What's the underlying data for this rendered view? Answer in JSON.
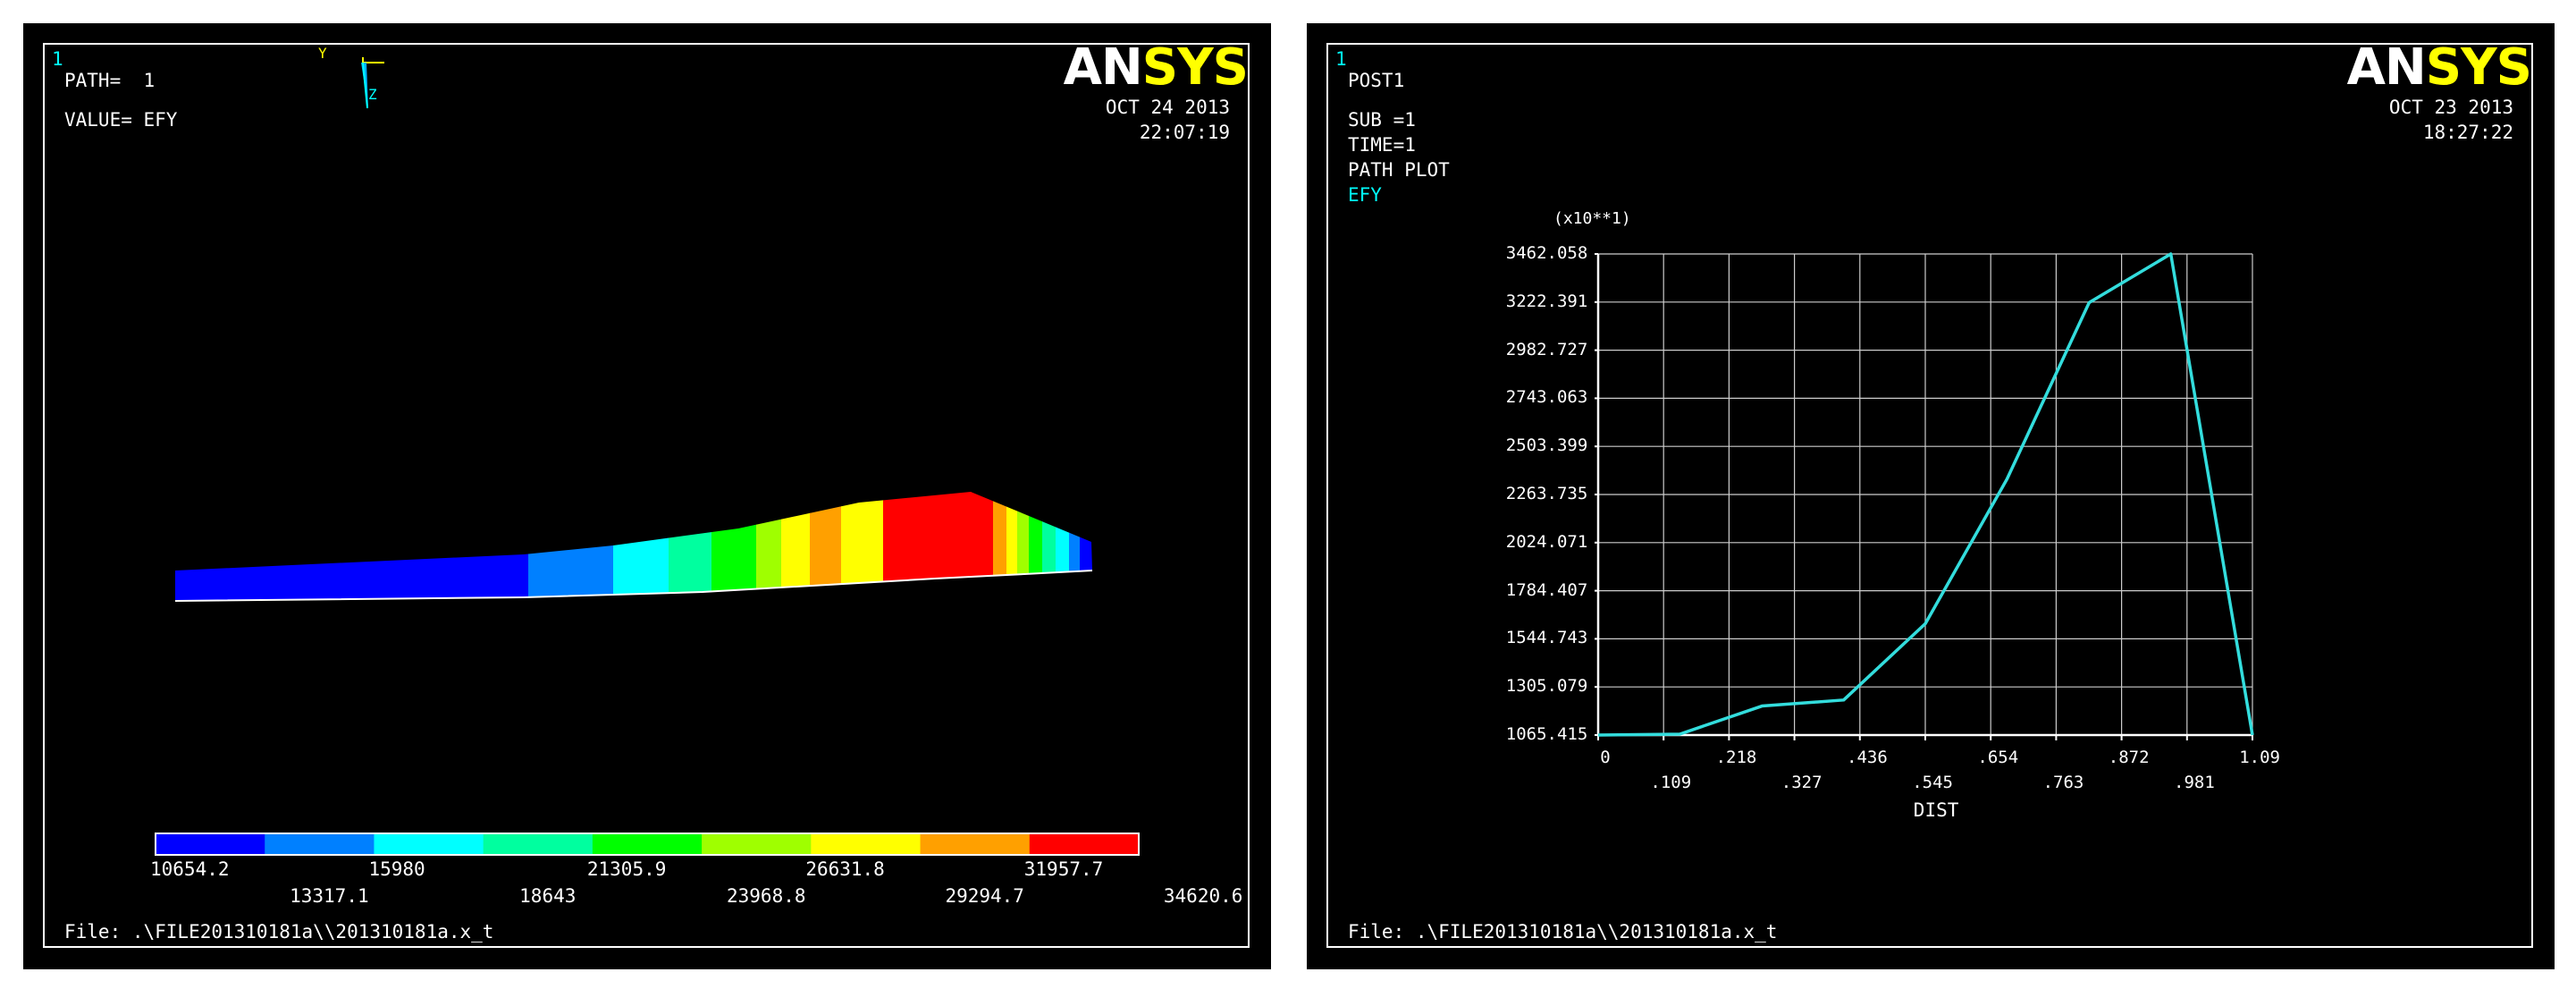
{
  "left_panel": {
    "window_number": "1",
    "path_label": "PATH=  1",
    "value_label": "VALUE= EFY",
    "logo_an": "AN",
    "logo_sys": "SYS",
    "date": "OCT 24 2013",
    "time": "22:07:19",
    "triad_y": "Y",
    "triad_z": "Z",
    "file_label": "File: .\\FILE201310181a\\\\201310181a.x_t",
    "colors": [
      "#0000ff",
      "#0080ff",
      "#00ffff",
      "#00ff9f",
      "#00ff00",
      "#9fff00",
      "#ffff00",
      "#ffa000",
      "#ff0000"
    ],
    "contour_bar": {
      "top_labels": [
        "10654.2",
        "15980",
        "21305.9",
        "26631.8",
        "31957.7"
      ],
      "bottom_labels": [
        "13317.1",
        "18643",
        "23968.8",
        "29294.7",
        "34620.6"
      ]
    }
  },
  "right_panel": {
    "window_number": "1",
    "post_label": "POST1",
    "sub_label": "SUB =1",
    "time_label": "TIME=1",
    "plot_label": "PATH PLOT",
    "series_label": "EFY",
    "logo_an": "AN",
    "logo_sys": "SYS",
    "date": "OCT 23 2013",
    "time": "18:27:22",
    "file_label": "File: .\\FILE201310181a\\\\201310181a.x_t"
  },
  "chart_data": {
    "type": "line",
    "title": "",
    "xlabel": "DIST",
    "ylabel": "",
    "y_multiplier_label": "(x10**1)",
    "xlim": [
      0,
      1.09
    ],
    "ylim": [
      1065.415,
      3462.058
    ],
    "grid": true,
    "x_ticks_top": [
      "0",
      ".218",
      ".436",
      ".654",
      ".872",
      "1.09"
    ],
    "x_ticks_bottom": [
      ".109",
      ".327",
      ".545",
      ".763",
      ".981"
    ],
    "x_tick_values": [
      0,
      0.109,
      0.218,
      0.327,
      0.436,
      0.545,
      0.654,
      0.763,
      0.872,
      0.981,
      1.09
    ],
    "y_ticks": [
      "1065.415",
      "1305.079",
      "1544.743",
      "1784.407",
      "2024.071",
      "2263.735",
      "2503.399",
      "2743.063",
      "2982.727",
      "3222.391",
      "3462.058"
    ],
    "series": [
      {
        "color": "#33dddd",
        "x": [
          0,
          0.136,
          0.273,
          0.409,
          0.545,
          0.681,
          0.818,
          0.954,
          1.09
        ],
        "y": [
          1065.4,
          1070,
          1210,
          1240,
          1620,
          2340,
          3220,
          3462,
          1065.4
        ]
      }
    ]
  }
}
